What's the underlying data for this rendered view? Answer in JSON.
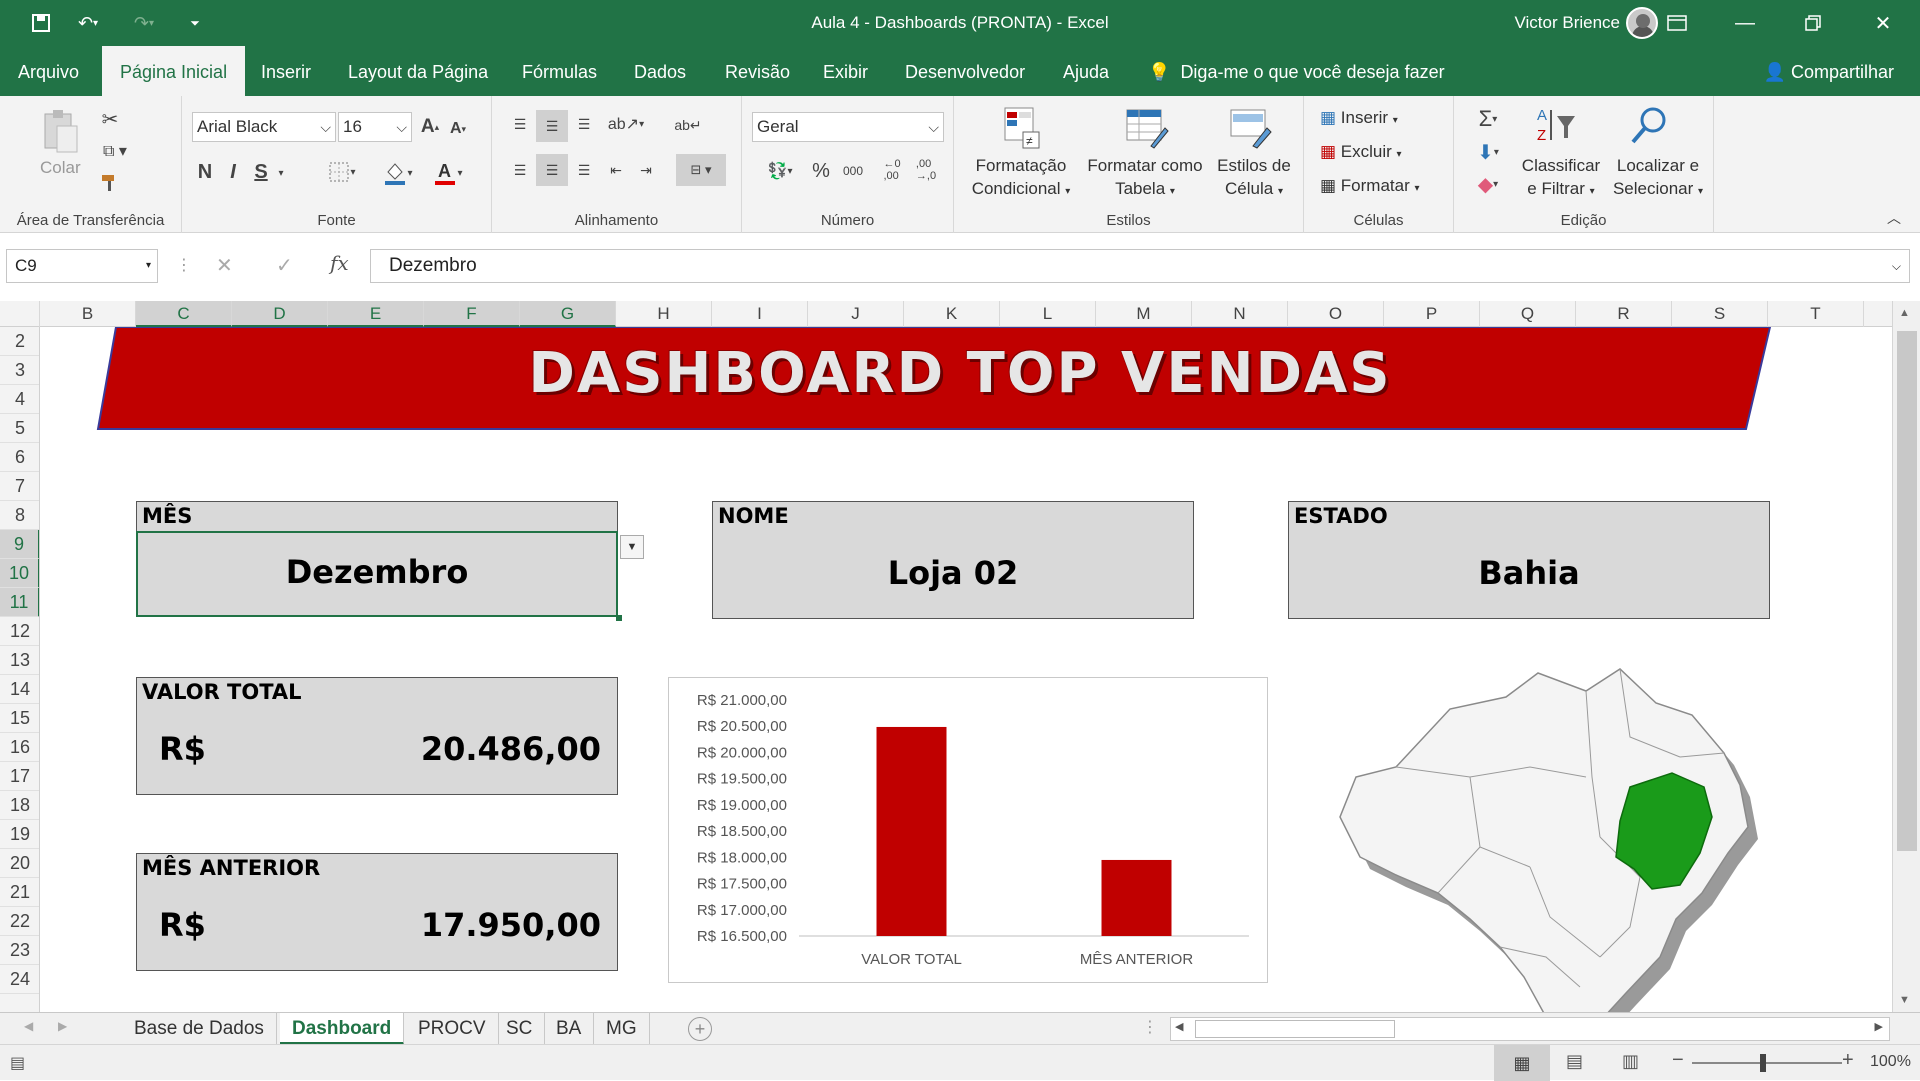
{
  "window": {
    "document_title": "Aula 4 - Dashboards (PRONTA)  -  Excel",
    "user": "Victor Brience"
  },
  "menu_tabs": [
    "Arquivo",
    "Página Inicial",
    "Inserir",
    "Layout da Página",
    "Fórmulas",
    "Dados",
    "Revisão",
    "Exibir",
    "Desenvolvedor",
    "Ajuda"
  ],
  "tell_me": "Diga-me o que você deseja fazer",
  "share_label": "Compartilhar",
  "ribbon": {
    "clipboard": {
      "paste": "Colar",
      "group": "Área de Transferência"
    },
    "font": {
      "name": "Arial Black",
      "size": "16",
      "group": "Fonte",
      "bold": "N",
      "italic": "I",
      "underline": "S"
    },
    "alignment": {
      "group": "Alinhamento"
    },
    "number": {
      "format": "Geral",
      "group": "Número",
      "percent": "%",
      "thousands": "000"
    },
    "styles": {
      "group": "Estilos",
      "cond_line1": "Formatação",
      "cond_line2": "Condicional",
      "table_line1": "Formatar como",
      "table_line2": "Tabela",
      "cell_line1": "Estilos de",
      "cell_line2": "Célula"
    },
    "cells": {
      "group": "Células",
      "insert": "Inserir",
      "delete": "Excluir",
      "format": "Formatar"
    },
    "editing": {
      "group": "Edição",
      "sort_line1": "Classificar",
      "sort_line2": "e Filtrar",
      "find_line1": "Localizar e",
      "find_line2": "Selecionar"
    }
  },
  "formula_bar": {
    "name_box": "C9",
    "formula": "Dezembro"
  },
  "columns": [
    "B",
    "C",
    "D",
    "E",
    "F",
    "G",
    "H",
    "I",
    "J",
    "K",
    "L",
    "M",
    "N",
    "O",
    "P",
    "Q",
    "R",
    "S",
    "T"
  ],
  "rows": [
    "2",
    "3",
    "4",
    "5",
    "6",
    "7",
    "8",
    "9",
    "10",
    "11",
    "12",
    "13",
    "14",
    "15",
    "16",
    "17",
    "18",
    "19",
    "20",
    "21",
    "22",
    "23",
    "24"
  ],
  "dashboard": {
    "title": "DASHBOARD TOP VENDAS",
    "mes": {
      "label": "MÊS",
      "value": "Dezembro"
    },
    "nome": {
      "label": "NOME",
      "value": "Loja 02"
    },
    "estado": {
      "label": "ESTADO",
      "value": "Bahia"
    },
    "valor_total": {
      "label": "VALOR TOTAL",
      "currency": "R$",
      "value": "20.486,00"
    },
    "mes_anterior": {
      "label": "MÊS ANTERIOR",
      "currency": "R$",
      "value": "17.950,00"
    },
    "map_highlight_color": "#1a9b1a"
  },
  "chart_data": {
    "type": "bar",
    "categories": [
      "VALOR TOTAL",
      "MÊS ANTERIOR"
    ],
    "values": [
      20486,
      17950
    ],
    "ylim": [
      16500,
      21000
    ],
    "y_ticks": [
      "R$ 16.500,00",
      "R$ 17.000,00",
      "R$ 17.500,00",
      "R$ 18.000,00",
      "R$ 18.500,00",
      "R$ 19.000,00",
      "R$ 19.500,00",
      "R$ 20.000,00",
      "R$ 20.500,00",
      "R$ 21.000,00"
    ],
    "bar_color": "#c00000",
    "grid": false
  },
  "sheet_tabs": [
    "Base de Dados",
    "Dashboard",
    "PROCV",
    "SC",
    "BA",
    "MG"
  ],
  "status": {
    "zoom": "100%"
  }
}
